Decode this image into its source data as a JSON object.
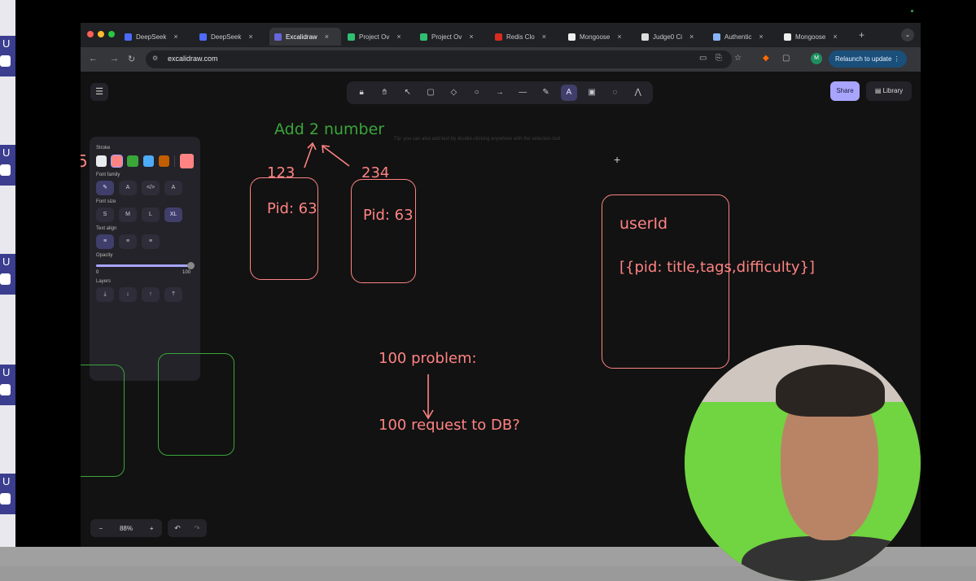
{
  "browser": {
    "tabs": [
      {
        "label": "DeepSeek",
        "fav": "#4d6bfe"
      },
      {
        "label": "DeepSeek",
        "fav": "#4d6bfe"
      },
      {
        "label": "Excalidraw",
        "fav": "#6965db",
        "active": true
      },
      {
        "label": "Project Ov",
        "fav": "#2fbf71"
      },
      {
        "label": "Project Ov",
        "fav": "#2fbf71"
      },
      {
        "label": "Redis Clo",
        "fav": "#d82c20"
      },
      {
        "label": "Mongoose",
        "fav": "#eeeeee"
      },
      {
        "label": "Judge0 Ci",
        "fav": "#dddddd"
      },
      {
        "label": "Authentic",
        "fav": "#8ab4f8"
      },
      {
        "label": "Mongoose",
        "fav": "#eeeeee"
      }
    ],
    "url": "excalidraw.com",
    "relaunch_label": "Relaunch to update",
    "avatar_letter": "M"
  },
  "excalidraw": {
    "tip": "Tip: you can also add text by double-clicking anywhere with the selection tool",
    "share_label": "Share",
    "library_label": "Library",
    "tools": [
      {
        "icon": "lock-icon",
        "glyph": "🔒︎"
      },
      {
        "icon": "hand-icon",
        "glyph": "✋︎"
      },
      {
        "icon": "selection-icon",
        "glyph": "↖"
      },
      {
        "icon": "rectangle-icon",
        "glyph": "▢"
      },
      {
        "icon": "diamond-icon",
        "glyph": "◇"
      },
      {
        "icon": "ellipse-icon",
        "glyph": "○"
      },
      {
        "icon": "arrow-icon",
        "glyph": "→"
      },
      {
        "icon": "line-icon",
        "glyph": "—"
      },
      {
        "icon": "draw-icon",
        "glyph": "✎"
      },
      {
        "icon": "text-icon",
        "glyph": "A",
        "active": true
      },
      {
        "icon": "image-icon",
        "glyph": "▣"
      },
      {
        "icon": "eraser-icon",
        "glyph": "◌"
      },
      {
        "icon": "more-tools-icon",
        "glyph": "⋀"
      }
    ],
    "props": {
      "stroke_title": "Stroke",
      "stroke_colors": [
        "#e9ecef",
        "#ff8383",
        "#3aa63a",
        "#4dabf7",
        "#c25e00"
      ],
      "stroke_current": "#ff8383",
      "font_family_title": "Font family",
      "font_family_options": [
        "✎",
        "A",
        "</>",
        "A"
      ],
      "font_size_title": "Font size",
      "font_size_options": [
        "S",
        "M",
        "L",
        "XL"
      ],
      "text_align_title": "Text align",
      "text_align_options": [
        "≡",
        "≡",
        "≡"
      ],
      "opacity_title": "Opacity",
      "opacity_min": "0",
      "opacity_max": "100",
      "opacity_value": 100,
      "layers_title": "Layers",
      "layers_options": [
        "⤓",
        "↓",
        "↑",
        "⤒"
      ]
    },
    "zoom": "88%",
    "canvas_text": {
      "left_number": "5",
      "add_title": "Add 2 number",
      "num1": "123",
      "num2": "234",
      "pid1": "Pid: 63",
      "pid2": "Pid: 63",
      "user_id": "userId",
      "list": "[{pid: title,tags,difficulty}]",
      "problem": "100 problem:",
      "request": "100 request to DB?"
    }
  },
  "left_strip": {
    "letter": "U"
  }
}
